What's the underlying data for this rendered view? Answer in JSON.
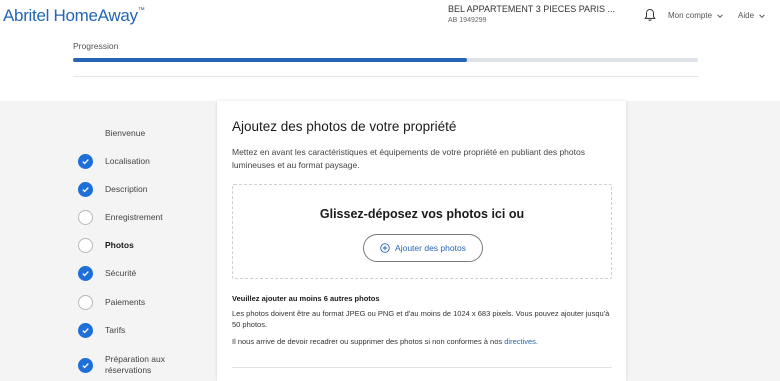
{
  "header": {
    "logo": "Abritel HomeAway",
    "logo_tm": "™",
    "property_name": "BEL APPARTEMENT 3 PIECES PARIS ...",
    "property_id": "AB 1949299",
    "notifications_icon": "bell-icon",
    "account_label": "Mon compte",
    "help_label": "Aide"
  },
  "progress": {
    "label": "Progression",
    "fraction": 0.63
  },
  "steps": [
    {
      "label": "Bienvenue",
      "status": "none"
    },
    {
      "label": "Localisation",
      "status": "done"
    },
    {
      "label": "Description",
      "status": "done"
    },
    {
      "label": "Enregistrement",
      "status": "todo"
    },
    {
      "label": "Photos",
      "status": "active"
    },
    {
      "label": "Sécurité",
      "status": "done"
    },
    {
      "label": "Paiements",
      "status": "todo"
    },
    {
      "label": "Tarifs",
      "status": "done"
    },
    {
      "label": "Préparation aux réservations",
      "status": "done"
    }
  ],
  "card": {
    "title": "Ajoutez des photos de votre propriété",
    "description": "Mettez en avant les caractéristiques et équipements de votre propriété en publiant des photos lumineuses et au format paysage.",
    "dropzone_title": "Glissez-déposez vos photos ici ou",
    "add_button": "Ajouter des photos",
    "requirement_title": "Veuillez ajouter au moins 6 autres photos",
    "requirement_text": "Les photos doivent être au format JPEG ou PNG et d'au moins de 1024 x 683 pixels. Vous pouvez ajouter jusqu'à 50 photos.",
    "crop_text": "Il nous arrive de devoir recadrer ou supprimer des photos si non conformes à nos",
    "crop_link": "directives",
    "crop_end": "."
  },
  "colors": {
    "accent": "#2466b5",
    "done": "#1e6fd9"
  }
}
